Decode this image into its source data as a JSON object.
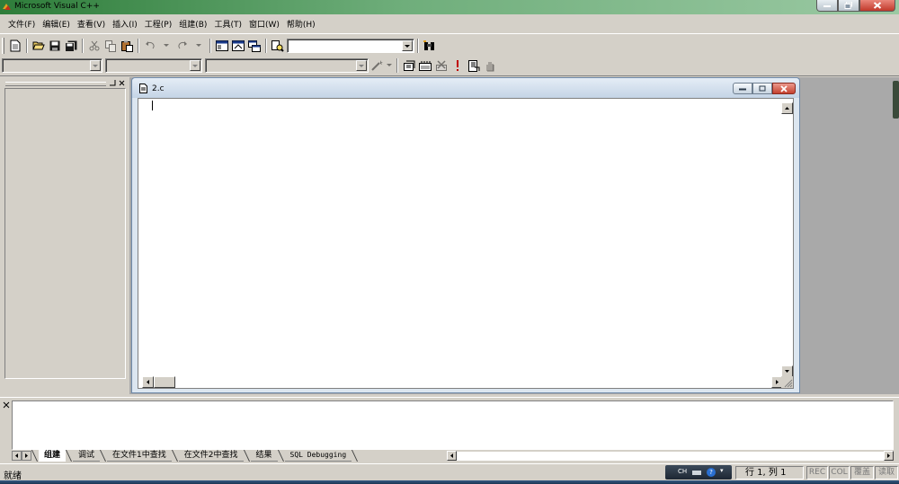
{
  "window": {
    "title": "Microsoft Visual C++"
  },
  "menu": [
    "文件(F)",
    "编辑(E)",
    "查看(V)",
    "插入(I)",
    "工程(P)",
    "组建(B)",
    "工具(T)",
    "窗口(W)",
    "帮助(H)"
  ],
  "toolbar": {
    "find_combo_value": "",
    "wizard_class_value": "",
    "wizard_filter_value": "",
    "wizard_member_value": ""
  },
  "document": {
    "name": "2.c",
    "content": ""
  },
  "output": {
    "tabs": [
      "组建",
      "调试",
      "在文件1中查找",
      "在文件2中查找",
      "结果",
      "SQL Debugging"
    ],
    "active_tab": 0
  },
  "status": {
    "message": "就绪",
    "position": "行 1, 列 1",
    "indicators": [
      "REC",
      "COL",
      "覆盖",
      "读取"
    ],
    "ime": "CH",
    "help_glyph": "?"
  },
  "icons": {
    "app": "vc-app-icon",
    "colors": {
      "title_green": "#2e7d3a",
      "mdi_background": "#a9a9a9",
      "child_title": "#c4d4e6"
    }
  }
}
